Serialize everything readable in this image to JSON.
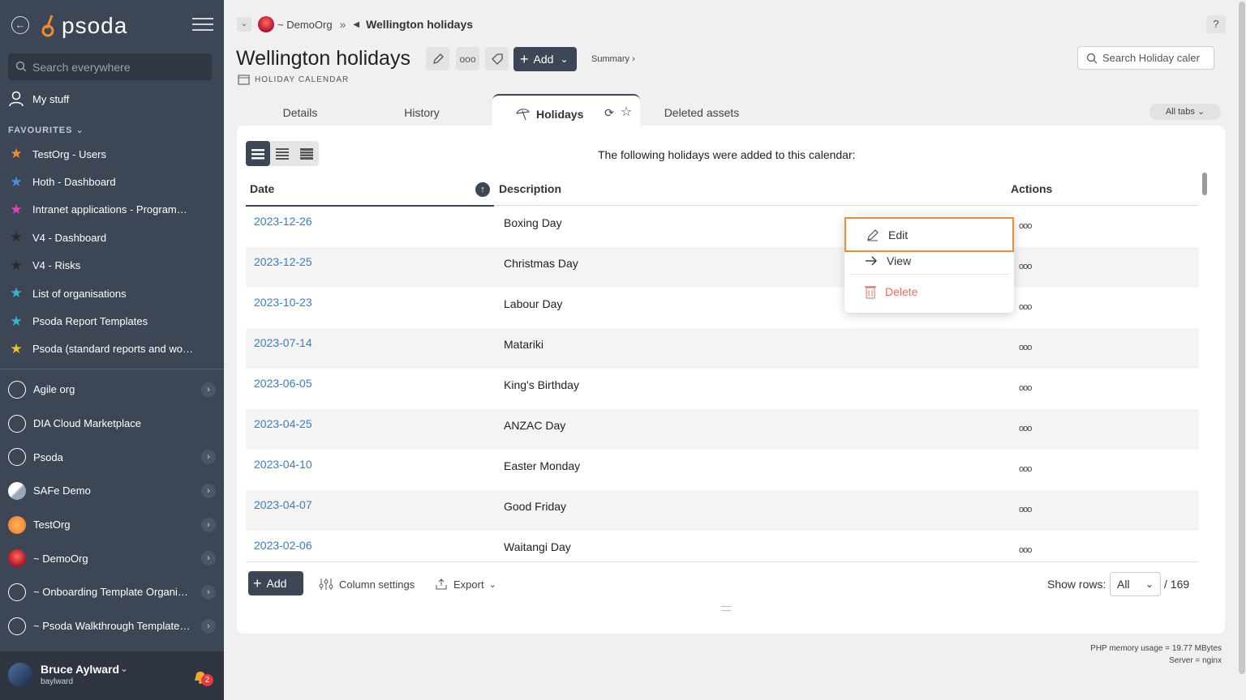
{
  "sidebar": {
    "logo_text": "psoda",
    "search_placeholder": "Search everywhere",
    "my_stuff": "My stuff",
    "favourites_heading": "FAVOURITES",
    "favourites": [
      {
        "label": "TestOrg - Users",
        "star_color": "#f28a2e"
      },
      {
        "label": "Hoth - Dashboard",
        "star_color": "#4a90e2"
      },
      {
        "label": "Intranet applications - Programme Dashboard",
        "star_color": "#e040c8"
      },
      {
        "label": "V4 - Dashboard",
        "star_color": "#2b2b2b"
      },
      {
        "label": "V4 - Risks",
        "star_color": "#2b2b2b"
      },
      {
        "label": "List of organisations",
        "star_color": "#32b8d6"
      },
      {
        "label": "Psoda Report Templates",
        "star_color": "#32b8d6"
      },
      {
        "label": "Psoda (standard reports and workflows)",
        "star_color": "#e8c22a"
      }
    ],
    "orgs": [
      {
        "label": "Agile org",
        "icon": "compass-icon",
        "chevron": true
      },
      {
        "label": "DIA Cloud Marketplace",
        "icon": "compass-icon",
        "chevron": false
      },
      {
        "label": "Psoda",
        "icon": "compass-icon",
        "chevron": true
      },
      {
        "label": "SAFe Demo",
        "icon": "org-logo-icon",
        "chevron": true
      },
      {
        "label": "TestOrg",
        "icon": "org-logo-icon",
        "chevron": true
      },
      {
        "label": "~ DemoOrg",
        "icon": "org-logo-icon",
        "chevron": true
      },
      {
        "label": "~ Onboarding Template Organisation",
        "icon": "compass-icon",
        "chevron": true
      },
      {
        "label": "~ Psoda Walkthrough Template Portfolio",
        "icon": "compass-icon",
        "chevron": true
      }
    ],
    "user": {
      "name": "Bruce Aylward",
      "handle": "baylward",
      "notifications": "2"
    }
  },
  "breadcrumb": {
    "org": "~ DemoOrg",
    "separator": "»",
    "current": "Wellington holidays"
  },
  "header": {
    "title": "Wellington holidays",
    "subtitle": "HOLIDAY CALENDAR",
    "add_label": "Add",
    "summary_label": "Summary ›",
    "search_placeholder": "Search Holiday caler",
    "help": "?"
  },
  "tabs": [
    {
      "label": "Details"
    },
    {
      "label": "History"
    },
    {
      "label": "Holidays",
      "active": true
    },
    {
      "label": "Deleted assets"
    }
  ],
  "all_tabs_label": "All tabs",
  "table": {
    "intro": "The following holidays were added to this calendar:",
    "columns": [
      "Date",
      "Description",
      "Actions"
    ],
    "rows": [
      {
        "date": "2023-12-26",
        "description": "Boxing Day"
      },
      {
        "date": "2023-12-25",
        "description": "Christmas Day"
      },
      {
        "date": "2023-10-23",
        "description": "Labour Day"
      },
      {
        "date": "2023-07-14",
        "description": "Matariki"
      },
      {
        "date": "2023-06-05",
        "description": "King's Birthday"
      },
      {
        "date": "2023-04-25",
        "description": "ANZAC Day"
      },
      {
        "date": "2023-04-10",
        "description": "Easter Monday"
      },
      {
        "date": "2023-04-07",
        "description": "Good Friday"
      },
      {
        "date": "2023-02-06",
        "description": "Waitangi Day"
      }
    ],
    "actions_glyph": "ooo"
  },
  "footer": {
    "add_label": "Add",
    "column_settings": "Column settings",
    "export": "Export",
    "show_rows_label": "Show rows:",
    "show_rows_value": "All",
    "total": "/ 169"
  },
  "context_menu": {
    "edit": "Edit",
    "view": "View",
    "delete": "Delete"
  },
  "server_info": {
    "memory": "PHP memory usage = 19.77 MBytes",
    "server": "Server = nginx"
  },
  "colors": {
    "sidebar": "#3d4654",
    "accent_link": "#3a7cc0",
    "highlight": "#f28a2e",
    "delete": "#e56d5d"
  }
}
